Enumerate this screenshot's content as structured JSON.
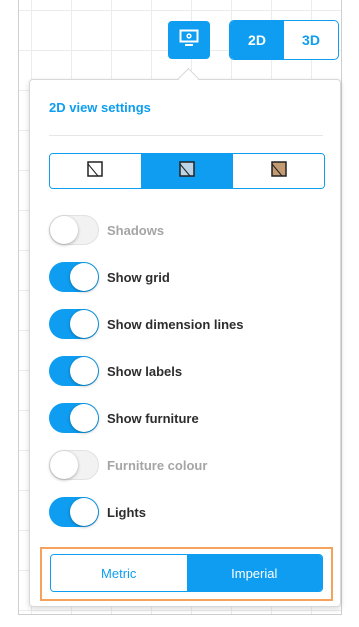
{
  "colors": {
    "accent": "#0e9df0",
    "highlight_border": "#f5a25d"
  },
  "toolbar": {
    "settings_icon": "monitor-settings-icon",
    "view_modes": [
      {
        "label": "2D",
        "active": true
      },
      {
        "label": "3D",
        "active": false
      }
    ]
  },
  "panel": {
    "title": "2D view settings",
    "styles": [
      {
        "icon": "outline-style-icon",
        "active": false
      },
      {
        "icon": "blueprint-style-icon",
        "active": true
      },
      {
        "icon": "textured-style-icon",
        "active": false
      }
    ],
    "toggles": [
      {
        "label": "Shadows",
        "on": false
      },
      {
        "label": "Show grid",
        "on": true
      },
      {
        "label": "Show dimension lines",
        "on": true
      },
      {
        "label": "Show labels",
        "on": true
      },
      {
        "label": "Show furniture",
        "on": true
      },
      {
        "label": "Furniture colour",
        "on": false
      },
      {
        "label": "Lights",
        "on": true
      }
    ],
    "units": [
      {
        "label": "Metric",
        "active": false
      },
      {
        "label": "Imperial",
        "active": true
      }
    ]
  }
}
